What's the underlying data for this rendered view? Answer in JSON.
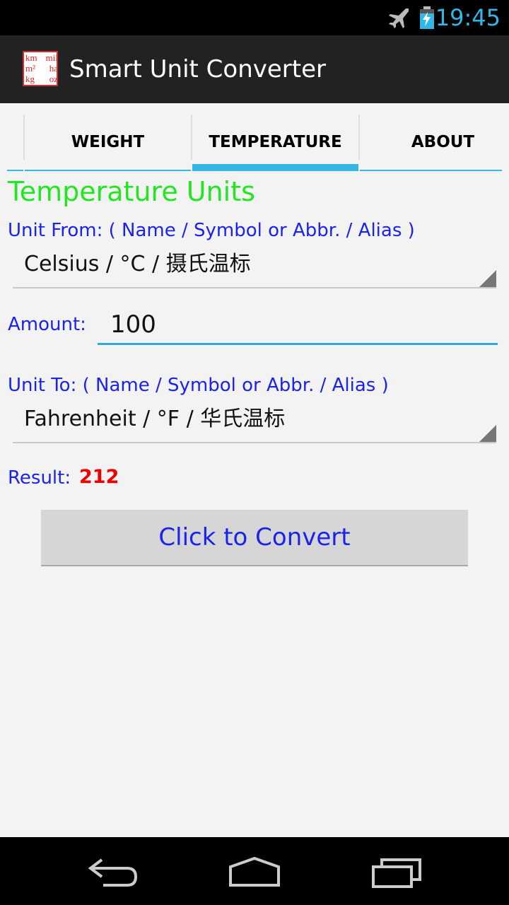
{
  "status_bar": {
    "time": "19:45",
    "icons": [
      "airplane-mode-icon",
      "battery-charging-icon"
    ]
  },
  "app": {
    "title": "Smart Unit Converter",
    "icon_rows": [
      [
        "km",
        "mil"
      ],
      [
        "m²",
        "ha"
      ],
      [
        "kg",
        "oz"
      ]
    ]
  },
  "tabs": [
    {
      "label": "WEIGHT",
      "active": false
    },
    {
      "label": "TEMPERATURE",
      "active": true
    },
    {
      "label": "ABOUT",
      "active": false
    }
  ],
  "main": {
    "section_title": "Temperature Units",
    "unit_from_label": "Unit From: ( Name / Symbol or Abbr. / Alias )",
    "unit_from_value": "Celsius / °C / 摄氏温标",
    "amount_label": "Amount:",
    "amount_value": "100",
    "unit_to_label": "Unit To: ( Name / Symbol or Abbr. / Alias )",
    "unit_to_value": "Fahrenheit / °F / 华氏温标",
    "result_label": "Result:",
    "result_value": "212",
    "convert_button": "Click to Convert"
  },
  "nav_bar": {
    "buttons": [
      "back-icon",
      "home-icon",
      "recent-apps-icon"
    ]
  },
  "colors": {
    "accent": "#33b5e5",
    "section_title": "#22e622",
    "label": "#1a22ee",
    "result": "#ee0000"
  }
}
